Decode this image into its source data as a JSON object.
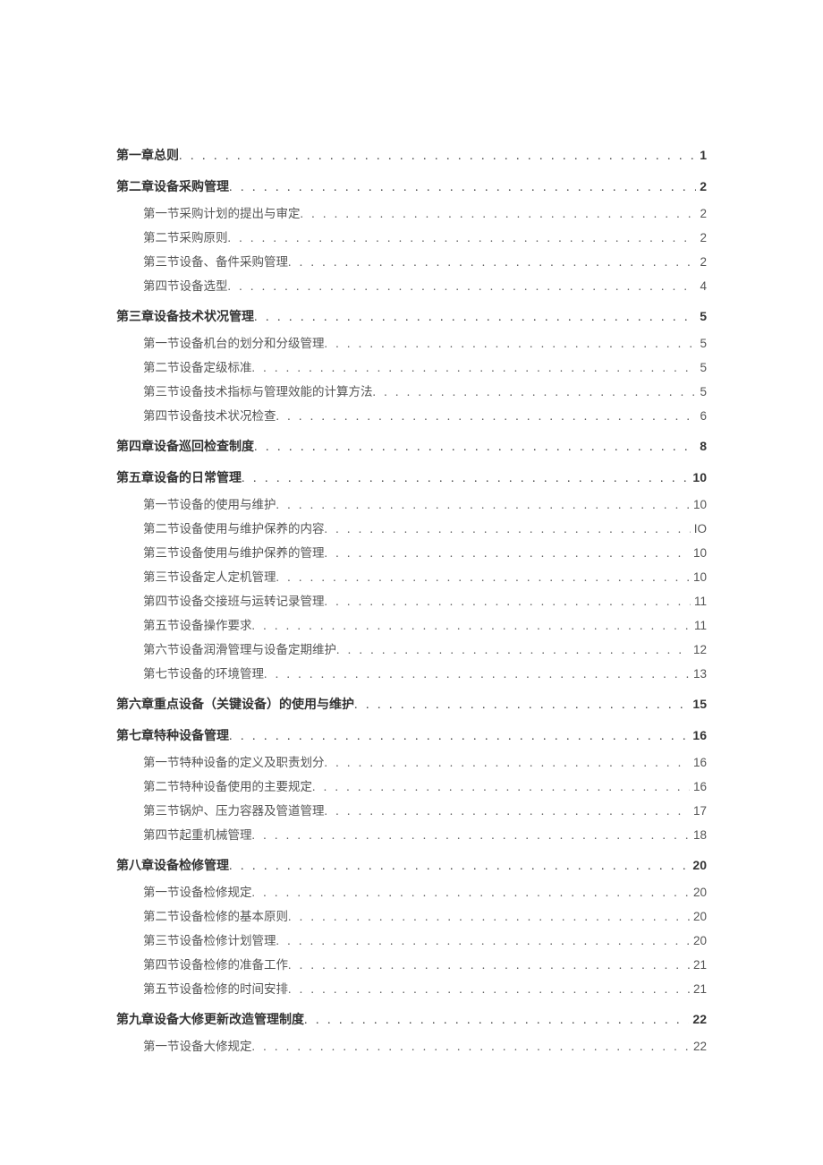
{
  "toc": [
    {
      "level": 1,
      "title": "第一章总则",
      "page": "1"
    },
    {
      "level": 1,
      "title": "第二章设备采购管理",
      "page": "2"
    },
    {
      "level": 2,
      "title": "第一节采购计划的提出与审定",
      "page": "2"
    },
    {
      "level": 2,
      "title": "第二节采购原则",
      "page": "2"
    },
    {
      "level": 2,
      "title": "第三节设备、备件采购管理",
      "page": "2"
    },
    {
      "level": 2,
      "title": "第四节设备选型",
      "page": "4"
    },
    {
      "level": 1,
      "title": "第三章设备技术状况管理",
      "page": "5"
    },
    {
      "level": 2,
      "title": "第一节设备机台的划分和分级管理",
      "page": "5"
    },
    {
      "level": 2,
      "title": "第二节设备定级标准",
      "page": "5"
    },
    {
      "level": 2,
      "title": "第三节设备技术指标与管理效能的计算方法",
      "page": "5"
    },
    {
      "level": 2,
      "title": "第四节设备技术状况检查",
      "page": "6"
    },
    {
      "level": 1,
      "title": "第四章设备巡回检查制度",
      "page": "8"
    },
    {
      "level": 1,
      "title": "第五章设备的日常管理",
      "page": "10"
    },
    {
      "level": 2,
      "title": "第一节设备的使用与维护",
      "page": "10"
    },
    {
      "level": 2,
      "title": "第二节设备使用与维护保养的内容",
      "page": "IO"
    },
    {
      "level": 2,
      "title": "第三节设备使用与维护保养的管理",
      "page": "10"
    },
    {
      "level": 2,
      "title": "第三节设备定人定机管理",
      "page": "10"
    },
    {
      "level": 2,
      "title": "第四节设备交接班与运转记录管理",
      "page": "11"
    },
    {
      "level": 2,
      "title": "第五节设备操作要求",
      "page": "11"
    },
    {
      "level": 2,
      "title": "第六节设备润滑管理与设备定期维护",
      "page": "12"
    },
    {
      "level": 2,
      "title": "第七节设备的环境管理",
      "page": "13"
    },
    {
      "level": 1,
      "title": "第六章重点设备（关键设备）的使用与维护",
      "page": "15"
    },
    {
      "level": 1,
      "title": "第七章特种设备管理",
      "page": "16"
    },
    {
      "level": 2,
      "title": "第一节特种设备的定义及职责划分",
      "page": "16"
    },
    {
      "level": 2,
      "title": "第二节特种设备使用的主要规定",
      "page": "16"
    },
    {
      "level": 2,
      "title": "第三节锅炉、压力容器及管道管理",
      "page": "17"
    },
    {
      "level": 2,
      "title": "第四节起重机械管理",
      "page": "18"
    },
    {
      "level": 1,
      "title": "第八章设备检修管理",
      "page": "20"
    },
    {
      "level": 2,
      "title": "第一节设备检修规定",
      "page": "20"
    },
    {
      "level": 2,
      "title": "第二节设备检修的基本原则",
      "page": "20"
    },
    {
      "level": 2,
      "title": "第三节设备检修计划管理",
      "page": "20"
    },
    {
      "level": 2,
      "title": "第四节设备检修的准备工作",
      "page": "21"
    },
    {
      "level": 2,
      "title": "第五节设备检修的时间安排",
      "page": "21"
    },
    {
      "level": 1,
      "title": "第九章设备大修更新改造管理制度",
      "page": "22"
    },
    {
      "level": 2,
      "title": "第一节设备大修规定",
      "page": "22"
    }
  ]
}
